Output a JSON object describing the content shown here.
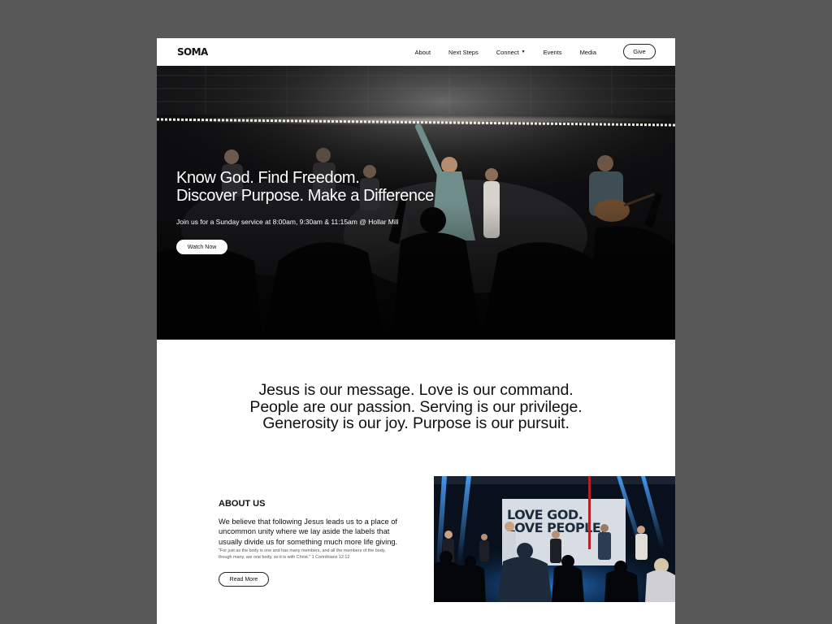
{
  "nav": {
    "logo": "SOMA",
    "links": [
      {
        "label": "About"
      },
      {
        "label": "Next Steps"
      },
      {
        "label": "Connect"
      },
      {
        "label": "Events"
      },
      {
        "label": "Media"
      }
    ],
    "give_label": "Give"
  },
  "hero": {
    "title_line1": "Know God. Find Freedom.",
    "title_line2": "Discover Purpose. Make a Difference",
    "subtitle": "Join us for a Sunday service at 8:00am, 9:30am & 11:15am @ Hollar Mill",
    "button_label": "Watch Now"
  },
  "mission": {
    "line1": "Jesus is our message. Love is our command.",
    "line2": "People are our passion. Serving is our privilege.",
    "line3": "Generosity is our joy. Purpose is our pursuit."
  },
  "about": {
    "title": "ABOUT US",
    "body_line1": "We believe that following Jesus leads us to a place of",
    "body_line2": "uncommon unity where we lay aside the labels that",
    "body_line3": "usually divide us for something much more life giving.",
    "quote_line1": "\"For just as the body is one and has many members, and all the members of the body,",
    "quote_line2": "though many, are one body, so it is with Christ.\" 1 Corinthians 12:12",
    "button_label": "Read More",
    "banner_line1": "LOVE GOD.",
    "banner_line2": "LOVE PEOPLE."
  },
  "colors": {
    "backdrop": "#585858",
    "page": "#ffffff",
    "hero_bg": "#0b0b0c",
    "stage_blue": "#1a6fd6"
  }
}
